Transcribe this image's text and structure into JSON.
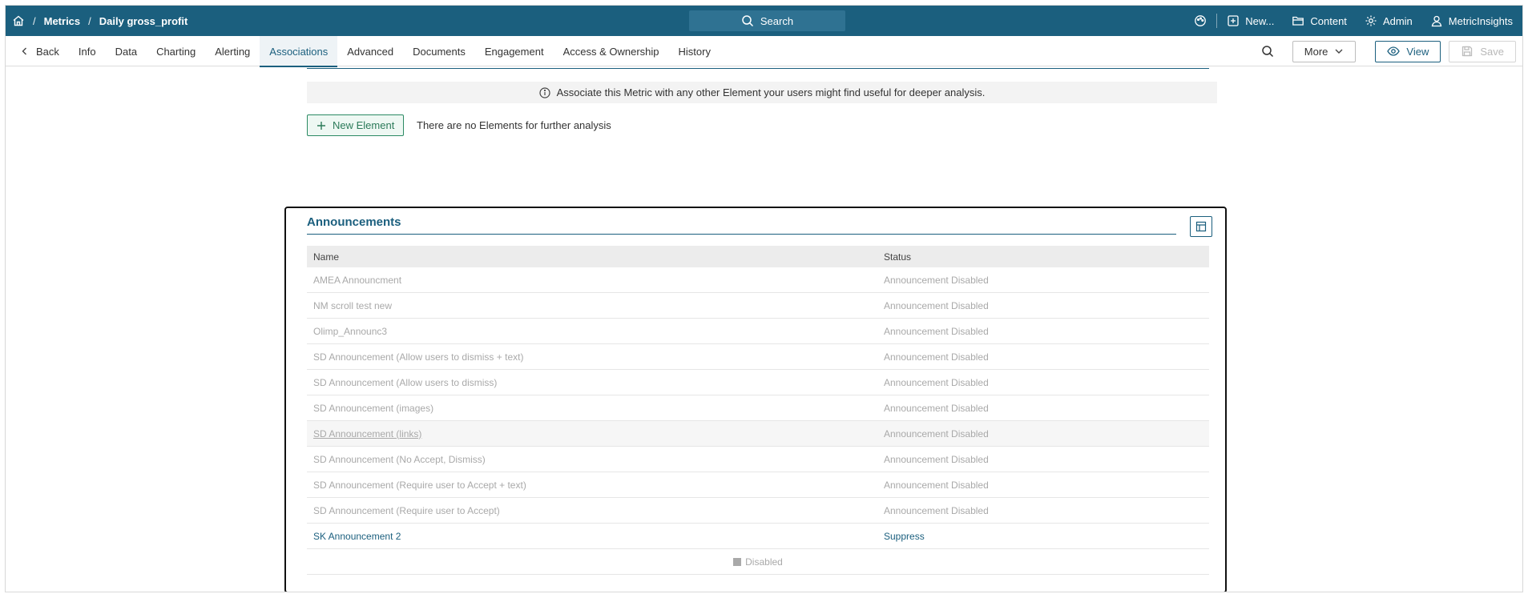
{
  "topbar": {
    "breadcrumb": [
      "Metrics",
      "Daily gross_profit"
    ],
    "search_label": "Search",
    "new_label": "New...",
    "content_label": "Content",
    "admin_label": "Admin",
    "user_label": "MetricInsights"
  },
  "tabs": {
    "back_label": "Back",
    "items": [
      "Info",
      "Data",
      "Charting",
      "Alerting",
      "Associations",
      "Advanced",
      "Documents",
      "Engagement",
      "Access & Ownership",
      "History"
    ],
    "active": "Associations"
  },
  "toolbar": {
    "more_label": "More",
    "view_label": "View",
    "save_label": "Save"
  },
  "associations": {
    "info_text": "Associate this Metric with any other Element your users might find useful for deeper analysis.",
    "new_element_label": "New Element",
    "empty_text": "There are no Elements for further analysis"
  },
  "announcements": {
    "title": "Announcements",
    "columns": [
      "Name",
      "Status"
    ],
    "rows": [
      {
        "name": "AMEA Announcment",
        "status": "Announcement Disabled"
      },
      {
        "name": "NM scroll test new",
        "status": "Announcement Disabled"
      },
      {
        "name": "Olimp_Announc3",
        "status": "Announcement Disabled"
      },
      {
        "name": "SD Announcement (Allow users to dismiss + text)",
        "status": "Announcement Disabled"
      },
      {
        "name": "SD Announcement (Allow users to dismiss)",
        "status": "Announcement Disabled"
      },
      {
        "name": "SD Announcement (images)",
        "status": "Announcement Disabled"
      },
      {
        "name": "SD Announcement (links)",
        "status": "Announcement Disabled"
      },
      {
        "name": "SD Announcement (No Accept, Dismiss)",
        "status": "Announcement Disabled"
      },
      {
        "name": "SD Announcement (Require user to Accept + text)",
        "status": "Announcement Disabled"
      },
      {
        "name": "SD Announcement (Require user to Accept)",
        "status": "Announcement Disabled"
      },
      {
        "name": "SK Announcement 2",
        "status": "Suppress"
      }
    ],
    "legend_label": "Disabled"
  },
  "colors": {
    "primary": "#1b5f7e",
    "success": "#2b8a63",
    "muted": "#a9a9a9"
  }
}
